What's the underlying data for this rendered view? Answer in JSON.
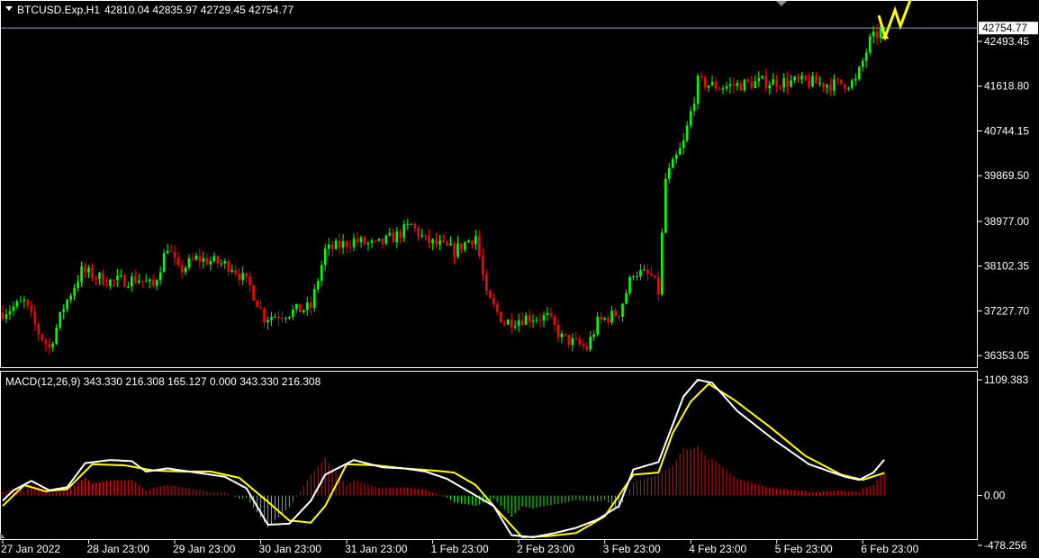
{
  "header": {
    "symbol": "BTCUSD.Exp,H1",
    "ohlc": "42810.04 42835.97 42729.45 42754.77"
  },
  "colors": {
    "background": "#000000",
    "frame": "#ffffff",
    "bull_candle": "#00ff00",
    "bear_candle": "#ff0000",
    "macd_line": "#ffffff",
    "signal_line": "#ffff00",
    "hist_positive": "#ff0000",
    "hist_negative": "#00ff00",
    "price_line": "#8fa0b8",
    "forecast_arrows": "#ffff00"
  },
  "price_panel": {
    "current_price_label": "42754.77",
    "current_price": 42754.77
  },
  "macd_panel": {
    "label": "MACD(12,26,9) 343.330 216.308 165.127 0.000 343.330 216.308",
    "axis_labels": [
      "1109.383",
      "0.00",
      "-478.256"
    ]
  },
  "chart_data": [
    {
      "type": "candlestick",
      "title": "BTCUSD.Exp,H1",
      "y_ticks": [
        "42493.45",
        "41618.80",
        "40744.15",
        "39869.50",
        "38977.00",
        "38102.35",
        "37227.70",
        "36353.05"
      ],
      "y_tick_values": [
        42493.45,
        41618.8,
        40744.15,
        39869.5,
        38977.0,
        38102.35,
        37227.7,
        36353.05
      ],
      "ylim": [
        36180,
        43250
      ],
      "bars_per_day": 24,
      "x_tick_labels": [
        "27 Jan 2022",
        "28 Jan 23:00",
        "29 Jan 23:00",
        "30 Jan 23:00",
        "31 Jan 23:00",
        "1 Feb 23:00",
        "2 Feb 23:00",
        "3 Feb 23:00",
        "4 Feb 23:00",
        "5 Feb 23:00",
        "6 Feb 23:00"
      ],
      "x_tick_bars": [
        0,
        24,
        48,
        72,
        96,
        120,
        144,
        168,
        192,
        216,
        240
      ],
      "close_path": [
        [
          0,
          37200
        ],
        [
          6,
          37400
        ],
        [
          10,
          36800
        ],
        [
          13,
          36500
        ],
        [
          17,
          37300
        ],
        [
          22,
          38000
        ],
        [
          30,
          37800
        ],
        [
          38,
          37850
        ],
        [
          42,
          37700
        ],
        [
          46,
          38500
        ],
        [
          49,
          38000
        ],
        [
          54,
          38250
        ],
        [
          58,
          38200
        ],
        [
          64,
          38100
        ],
        [
          69,
          37700
        ],
        [
          73,
          37100
        ],
        [
          80,
          37200
        ],
        [
          86,
          37300
        ],
        [
          90,
          38400
        ],
        [
          98,
          38600
        ],
        [
          104,
          38500
        ],
        [
          110,
          38700
        ],
        [
          114,
          38900
        ],
        [
          118,
          38600
        ],
        [
          126,
          38400
        ],
        [
          132,
          38700
        ],
        [
          135,
          37500
        ],
        [
          140,
          37000
        ],
        [
          146,
          37100
        ],
        [
          152,
          37100
        ],
        [
          156,
          36700
        ],
        [
          163,
          36500
        ],
        [
          166,
          37000
        ],
        [
          172,
          37200
        ],
        [
          176,
          38000
        ],
        [
          181,
          37900
        ],
        [
          183,
          37600
        ],
        [
          185,
          39800
        ],
        [
          190,
          40500
        ],
        [
          194,
          41700
        ],
        [
          200,
          41600
        ],
        [
          212,
          41700
        ],
        [
          224,
          41700
        ],
        [
          232,
          41650
        ],
        [
          238,
          41700
        ],
        [
          242,
          42500
        ],
        [
          246,
          42754.77
        ]
      ]
    },
    {
      "type": "line",
      "title": "MACD(12,26,9)",
      "ylim": [
        -478.256,
        1109.383
      ],
      "series": [
        {
          "name": "MACD",
          "points": [
            [
              0,
              -50
            ],
            [
              3,
              50
            ],
            [
              8,
              140
            ],
            [
              13,
              50
            ],
            [
              18,
              80
            ],
            [
              23,
              310
            ],
            [
              30,
              340
            ],
            [
              36,
              330
            ],
            [
              40,
              230
            ],
            [
              46,
              260
            ],
            [
              54,
              220
            ],
            [
              62,
              180
            ],
            [
              68,
              70
            ],
            [
              74,
              -280
            ],
            [
              80,
              -270
            ],
            [
              86,
              -50
            ],
            [
              90,
              200
            ],
            [
              98,
              340
            ],
            [
              106,
              270
            ],
            [
              112,
              260
            ],
            [
              118,
              230
            ],
            [
              124,
              160
            ],
            [
              130,
              40
            ],
            [
              137,
              -100
            ],
            [
              142,
              -380
            ],
            [
              148,
              -400
            ],
            [
              154,
              -360
            ],
            [
              160,
              -310
            ],
            [
              166,
              -230
            ],
            [
              172,
              -100
            ],
            [
              176,
              250
            ],
            [
              183,
              320
            ],
            [
              186,
              590
            ],
            [
              190,
              950
            ],
            [
              194,
              1110
            ],
            [
              198,
              1080
            ],
            [
              205,
              810
            ],
            [
              215,
              540
            ],
            [
              225,
              300
            ],
            [
              235,
              180
            ],
            [
              239,
              150
            ],
            [
              243,
              220
            ],
            [
              246,
              343.33
            ]
          ]
        },
        {
          "name": "Signal",
          "points": [
            [
              0,
              -100
            ],
            [
              6,
              100
            ],
            [
              12,
              40
            ],
            [
              18,
              60
            ],
            [
              25,
              300
            ],
            [
              34,
              290
            ],
            [
              42,
              240
            ],
            [
              50,
              230
            ],
            [
              58,
              230
            ],
            [
              66,
              170
            ],
            [
              74,
              -60
            ],
            [
              80,
              -240
            ],
            [
              86,
              -260
            ],
            [
              90,
              -100
            ],
            [
              96,
              300
            ],
            [
              104,
              290
            ],
            [
              112,
              260
            ],
            [
              120,
              240
            ],
            [
              126,
              220
            ],
            [
              132,
              100
            ],
            [
              138,
              -140
            ],
            [
              145,
              -400
            ],
            [
              152,
              -390
            ],
            [
              160,
              -360
            ],
            [
              168,
              -200
            ],
            [
              176,
              200
            ],
            [
              183,
              220
            ],
            [
              187,
              600
            ],
            [
              192,
              900
            ],
            [
              197,
              1070
            ],
            [
              204,
              920
            ],
            [
              214,
              660
            ],
            [
              224,
              380
            ],
            [
              234,
              200
            ],
            [
              240,
              150
            ],
            [
              246,
              216.308
            ]
          ]
        }
      ]
    }
  ]
}
